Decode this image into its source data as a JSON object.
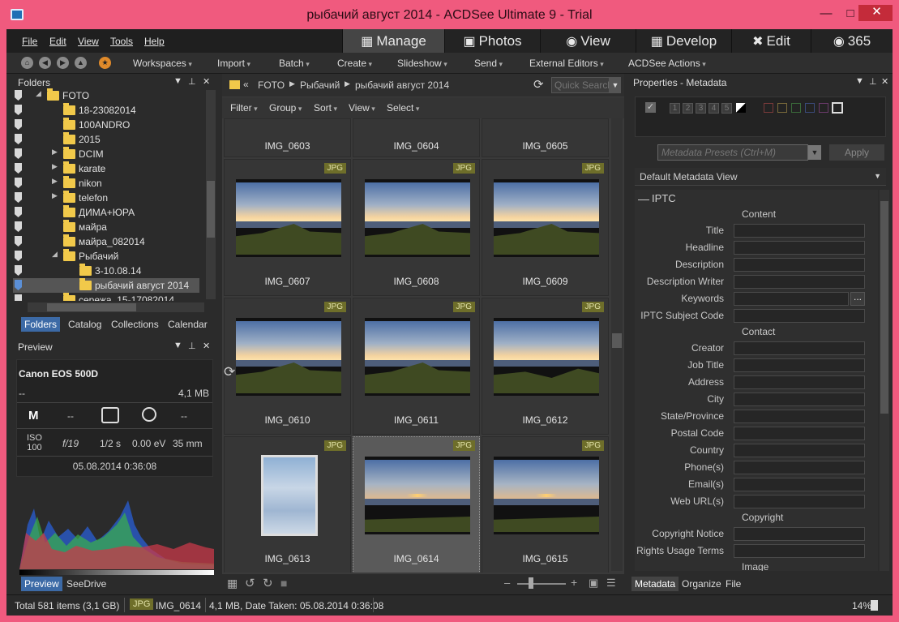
{
  "window": {
    "title": "рыбачий август 2014 - ACDSee Ultimate 9 - Trial"
  },
  "menu": [
    "File",
    "Edit",
    "View",
    "Tools",
    "Help"
  ],
  "modes": [
    {
      "label": "Manage",
      "icon": "grid-icon"
    },
    {
      "label": "Photos",
      "icon": "photos-icon"
    },
    {
      "label": "View",
      "icon": "eye-icon"
    },
    {
      "label": "Develop",
      "icon": "develop-icon"
    },
    {
      "label": "Edit",
      "icon": "edit-icon"
    },
    {
      "label": "365",
      "icon": "365-icon"
    }
  ],
  "toolbar": [
    "Workspaces",
    "Import",
    "Batch",
    "Create",
    "Slideshow",
    "Send",
    "External Editors",
    "ACDSee Actions"
  ],
  "folders_panel": {
    "title": "Folders",
    "tree": [
      {
        "label": "FOTO",
        "indent": 0
      },
      {
        "label": "18-23082014",
        "indent": 1
      },
      {
        "label": "100ANDRO",
        "indent": 1
      },
      {
        "label": "2015",
        "indent": 1
      },
      {
        "label": "DCIM",
        "indent": 1
      },
      {
        "label": "karate",
        "indent": 1
      },
      {
        "label": "nikon",
        "indent": 1
      },
      {
        "label": "telefon",
        "indent": 1
      },
      {
        "label": "ДИМА+ЮРА",
        "indent": 1
      },
      {
        "label": "майра",
        "indent": 1
      },
      {
        "label": "майра_082014",
        "indent": 1
      },
      {
        "label": "Рыбачий",
        "indent": 1
      },
      {
        "label": "3-10.08.14",
        "indent": 2
      },
      {
        "label": "рыбачий август 2014",
        "indent": 2
      },
      {
        "label": "сережа_15-17082014",
        "indent": 1
      }
    ],
    "tabs": [
      "Folders",
      "Catalog",
      "Collections",
      "Calendar"
    ]
  },
  "preview_panel": {
    "title": "Preview",
    "camera": "Canon EOS 500D",
    "dash": "--",
    "size": "4,1 MB",
    "mode": "M",
    "metering": "--",
    "flash": "--",
    "iso_label": "ISO",
    "iso": "100",
    "aperture": "f/19",
    "shutter": "1/2 s",
    "ev": "0.00 eV",
    "focal": "35 mm",
    "date": "05.08.2014 0:36:08",
    "tabs": [
      "Preview",
      "SeeDrive"
    ]
  },
  "browser": {
    "breadcrumb": [
      "FOTO",
      "Рыбачий",
      "рыбачий август 2014"
    ],
    "back_label": "«",
    "search_placeholder": "Quick Search",
    "filters": [
      "Filter",
      "Group",
      "Sort",
      "View",
      "Select"
    ],
    "top_row": [
      "IMG_0603",
      "IMG_0604",
      "IMG_0605"
    ],
    "items": [
      {
        "name": "IMG_0607",
        "badge": "JPG"
      },
      {
        "name": "IMG_0608",
        "badge": "JPG"
      },
      {
        "name": "IMG_0609",
        "badge": "JPG"
      },
      {
        "name": "IMG_0610",
        "badge": "JPG"
      },
      {
        "name": "IMG_0611",
        "badge": "JPG"
      },
      {
        "name": "IMG_0612",
        "badge": "JPG"
      },
      {
        "name": "IMG_0613",
        "badge": "JPG"
      },
      {
        "name": "IMG_0614",
        "badge": "JPG"
      },
      {
        "name": "IMG_0615",
        "badge": "JPG"
      }
    ]
  },
  "properties": {
    "title": "Properties - Metadata",
    "ratings": [
      "1",
      "2",
      "3",
      "4",
      "5"
    ],
    "preset_placeholder": "Metadata Presets (Ctrl+M)",
    "apply": "Apply",
    "view": "Default Metadata View",
    "section": "IPTC",
    "groups": [
      {
        "title": "Content",
        "fields": [
          "Title",
          "Headline",
          "Description",
          "Description Writer",
          "Keywords",
          "IPTC Subject Code"
        ]
      },
      {
        "title": "Contact",
        "fields": [
          "Creator",
          "Job Title",
          "Address",
          "City",
          "State/Province",
          "Postal Code",
          "Country",
          "Phone(s)",
          "Email(s)",
          "Web URL(s)"
        ]
      },
      {
        "title": "Copyright",
        "fields": [
          "Copyright Notice",
          "Rights Usage Terms"
        ]
      },
      {
        "title": "Image",
        "fields": []
      }
    ],
    "tabs": [
      "Metadata",
      "Organize",
      "File"
    ]
  },
  "status": {
    "total": "Total 581 items  (3,1 GB)",
    "type": "JPG",
    "file": "IMG_0614",
    "info": "4,1 MB, Date Taken: 05.08.2014 0:36:08",
    "zoom": "14%"
  },
  "colors": {
    "accent": "#3c6aa6",
    "titlebar": "#f05a7e",
    "badge": "#6e6e2a"
  }
}
